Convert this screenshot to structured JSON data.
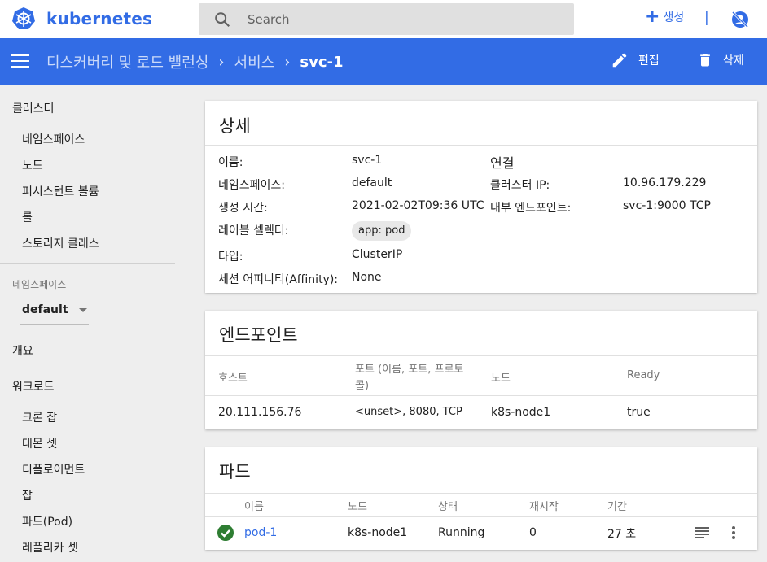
{
  "header": {
    "logo_text": "kubernetes",
    "search_placeholder": "Search",
    "create_label": "생성",
    "separator": "|"
  },
  "actionbar": {
    "breadcrumbs": [
      "디스커버리 및 로드 밸런싱",
      "서비스"
    ],
    "current": "svc-1",
    "edit_label": "편집",
    "delete_label": "삭제"
  },
  "sidebar": {
    "cluster_heading": "클러스터",
    "cluster_items": [
      "네임스페이스",
      "노드",
      "퍼시스턴트 볼륨",
      "롤",
      "스토리지 클래스"
    ],
    "namespace_label": "네임스페이스",
    "namespace_value": "default",
    "overview": "개요",
    "workloads_heading": "워크로드",
    "workload_items": [
      "크론 잡",
      "데몬 셋",
      "디플로이먼트",
      "잡",
      "파드(Pod)",
      "레플리카 셋"
    ]
  },
  "details": {
    "title": "상세",
    "fields": [
      {
        "label": "이름:",
        "value": "svc-1"
      },
      {
        "label": "네임스페이스:",
        "value": "default"
      },
      {
        "label": "생성 시간:",
        "value": "2021-02-02T09:36 UTC"
      },
      {
        "label": "레이블 셀렉터:",
        "value": "app: pod"
      },
      {
        "label": "타입:",
        "value": "ClusterIP"
      },
      {
        "label": "세션 어피니티(Affinity):",
        "value": "None"
      }
    ],
    "connection_title": "연결",
    "connection_fields": [
      {
        "label": "클러스터 IP:",
        "value": "10.96.179.229"
      },
      {
        "label": "내부 엔드포인트:",
        "value": "svc-1:9000 TCP"
      }
    ]
  },
  "endpoints": {
    "title": "엔드포인트",
    "columns": [
      "호스트",
      "포트 (이름, 포트, 프로토",
      "콜)",
      "노드",
      "Ready"
    ],
    "rows": [
      {
        "host": "20.111.156.76",
        "ports": "<unset>, 8080, TCP",
        "node": "k8s-node1",
        "ready": "true"
      }
    ]
  },
  "pods": {
    "title": "파드",
    "columns": [
      "이름",
      "노드",
      "상태",
      "재시작",
      "기간"
    ],
    "rows": [
      {
        "name": "pod-1",
        "node": "k8s-node1",
        "status": "Running",
        "restarts": "0",
        "age": "27 초"
      }
    ]
  },
  "colors": {
    "brand": "#326ce5",
    "status_ok": "#2e7d32"
  }
}
